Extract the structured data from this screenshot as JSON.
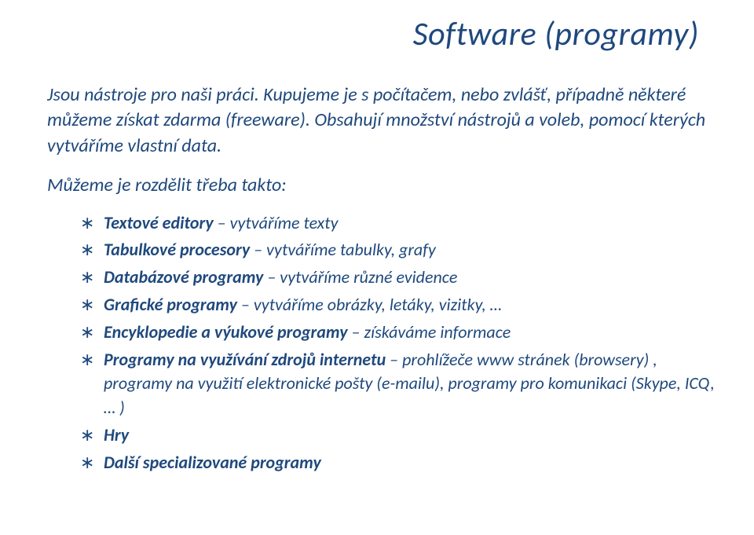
{
  "title": "Software (programy)",
  "para1": "Jsou nástroje pro naši práci. Kupujeme je s počítačem, nebo zvlášť, případně některé můžeme získat zdarma (freeware). Obsahují množství nástrojů a voleb, pomocí kterých vytváříme vlastní data.",
  "para2": "Můžeme je rozdělit třeba takto:",
  "items": {
    "i0": {
      "b": "Textové editory",
      "t": " – vytváříme texty"
    },
    "i1": {
      "b": "Tabulkové procesory",
      "t": " – vytváříme tabulky, grafy"
    },
    "i2": {
      "b": "Databázové programy",
      "t": " – vytváříme různé evidence"
    },
    "i3": {
      "b": "Grafické programy",
      "t": " – vytváříme obrázky, letáky, vizitky, …"
    },
    "i4": {
      "b": "Encyklopedie a výukové programy",
      "t": " – získáváme informace"
    },
    "i5": {
      "b": "Programy na využívání zdrojů internetu",
      "t": " – prohlížeče www stránek (browsery) , programy na využití elektronické pošty (e-mailu), programy pro komunikaci (Skype, ICQ, … )"
    },
    "i6": {
      "b": "Hry",
      "t": ""
    },
    "i7": {
      "b": "Další specializované programy",
      "t": ""
    }
  }
}
